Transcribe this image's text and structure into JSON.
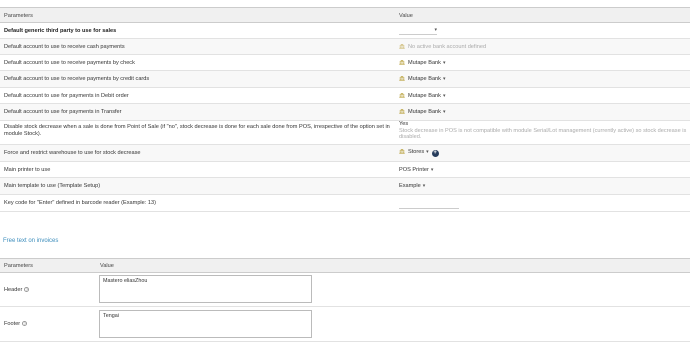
{
  "table1": {
    "header": {
      "parameters": "Parameters",
      "value": "Value"
    },
    "rows": {
      "generic_thirdparty": {
        "label": "Default generic third party to use for sales",
        "value": ""
      },
      "cash": {
        "label": "Default account to use to receive cash payments",
        "value": "No active bank account defined"
      },
      "check": {
        "label": "Default account to use to receive payments by check",
        "value": "Mutape Bank"
      },
      "cards": {
        "label": "Default account to use to receive payments by credit cards",
        "value": "Mutape Bank"
      },
      "debit": {
        "label": "Default account to use for payments in Debit order",
        "value": "Mutape Bank"
      },
      "transfer": {
        "label": "Default account to use for payments in Transfer",
        "value": "Mutape Bank"
      },
      "stock": {
        "label_line1": "Disable stock decrease when a sale is done from Point of Sale (if \"no\", stock decrease is done for each sale done from POS, irrespective of the option set in",
        "label_line2": "module Stock).",
        "value": "Yes",
        "note_line1": "Stock decrease in POS is not compatible with module Serial/Lot management (currently active) so stock decrease is",
        "note_line2": "disabled."
      },
      "warehouse": {
        "label": "Force and restrict warehouse to use for stock decrease",
        "value": "Stores"
      },
      "printer": {
        "label": "Main printer to use",
        "value": "POS Printer"
      },
      "template": {
        "label": "Main template to use (Template Setup)",
        "value": "Example"
      },
      "enter_key": {
        "label": "Key code for \"Enter\" defined in barcode reader (Example: 13)",
        "value": ""
      }
    }
  },
  "section_free_text": {
    "title": "Free text on invoices"
  },
  "table2": {
    "header": {
      "parameters": "Parameters",
      "value": "Value"
    },
    "rows": {
      "header_row": {
        "label": "Header",
        "value": "Mastero eliasZhou"
      },
      "footer_row": {
        "label": "Footer",
        "value": "Tengai"
      }
    }
  },
  "colors": {
    "link": "#3c8dbc",
    "bank_icon": "#b49a2e",
    "header_bg": "#f0f0f0",
    "plus_button": "#263c5c"
  }
}
